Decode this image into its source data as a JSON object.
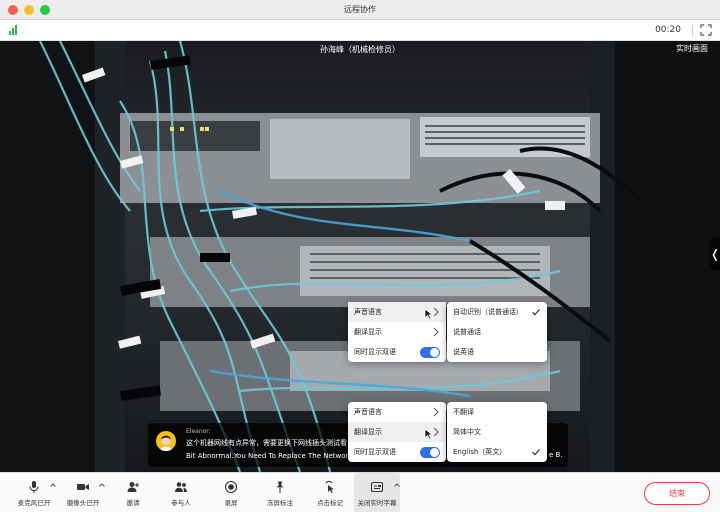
{
  "window": {
    "title": "远程协作"
  },
  "header": {
    "timer": "00:20"
  },
  "video": {
    "caller_name": "孙海峰（机械检修员）",
    "live_label": "实时画面",
    "side_handle": "❬"
  },
  "subtitle": {
    "speaker": "Eleanor:",
    "text_cn": "这个机器网线有点异常，需要更换下网线插头测试看",
    "text_en": "Bit Abnormal.You Need To Replace The Network"
  },
  "menu_top": {
    "items": [
      {
        "label": "声音语言"
      },
      {
        "label": "翻译显示"
      },
      {
        "label": "同时显示双语"
      }
    ]
  },
  "submenu_top": {
    "items": [
      {
        "label": "自动识别（说普通话）",
        "checked": true
      },
      {
        "label": "说普通话"
      },
      {
        "label": "说英语"
      }
    ]
  },
  "menu_bottom": {
    "items": [
      {
        "label": "声音语言"
      },
      {
        "label": "翻译显示"
      },
      {
        "label": "同时显示双语"
      }
    ]
  },
  "submenu_bottom": {
    "items": [
      {
        "label": "不翻译"
      },
      {
        "label": "简体中文"
      },
      {
        "label": "English（英文）",
        "checked": true
      }
    ],
    "clipped_text": "e B."
  },
  "toolbar": {
    "mic": "麦克风已开",
    "camera": "摄像头已开",
    "invite": "邀请",
    "participants": "参与人",
    "record": "录屏",
    "freeze": "冻屏标注",
    "click_mark": "点击标记",
    "captions": "关闭实时字幕",
    "end": "结束"
  },
  "colors": {
    "accent": "#2f6fe8",
    "danger": "#e04040",
    "signal": "#2cb34a",
    "cable": "#6ecad8"
  }
}
